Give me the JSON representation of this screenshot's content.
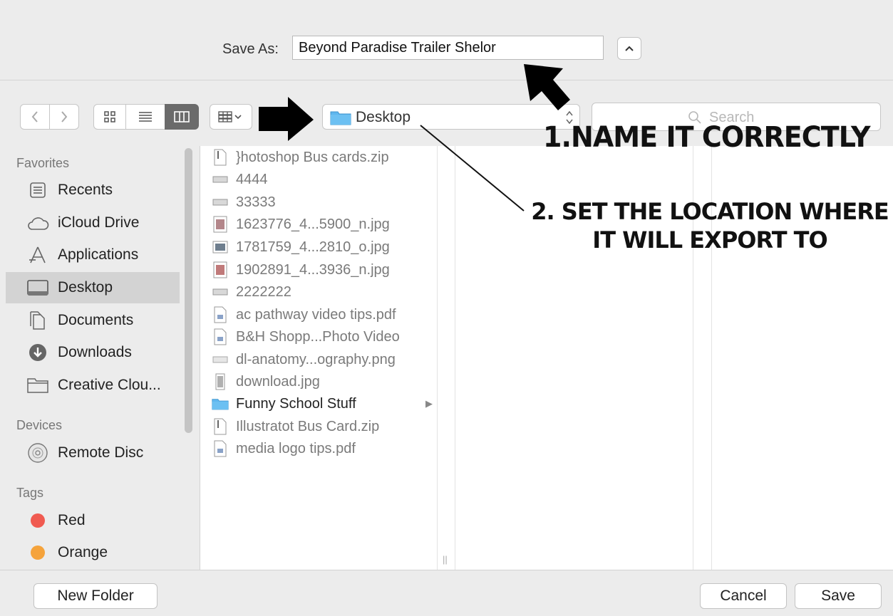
{
  "save_as": {
    "label": "Save As:",
    "filename": "Beyond Paradise Trailer Shelor"
  },
  "toolbar": {
    "location": "Desktop",
    "search_placeholder": "Search",
    "active_view": "column"
  },
  "sidebar": {
    "favorites_heading": "Favorites",
    "favorites": [
      {
        "label": "Recents",
        "icon": "recents-icon"
      },
      {
        "label": "iCloud Drive",
        "icon": "cloud-icon"
      },
      {
        "label": "Applications",
        "icon": "applications-icon"
      },
      {
        "label": "Desktop",
        "icon": "desktop-icon",
        "selected": true
      },
      {
        "label": "Documents",
        "icon": "documents-icon"
      },
      {
        "label": "Downloads",
        "icon": "downloads-icon"
      },
      {
        "label": "Creative Clou...",
        "icon": "folder-icon"
      }
    ],
    "devices_heading": "Devices",
    "devices": [
      {
        "label": "Remote Disc",
        "icon": "disc-icon"
      }
    ],
    "tags_heading": "Tags",
    "tags": [
      {
        "label": "Red",
        "color": "#f05a50"
      },
      {
        "label": "Orange",
        "color": "#f5a33b"
      }
    ]
  },
  "files": [
    {
      "name": "}hotoshop Bus cards.zip",
      "icon": "zip-icon"
    },
    {
      "name": "4444",
      "icon": "image-file-icon"
    },
    {
      "name": "33333",
      "icon": "image-file-icon"
    },
    {
      "name": "1623776_4...5900_n.jpg",
      "icon": "photo-icon"
    },
    {
      "name": "1781759_4...2810_o.jpg",
      "icon": "photo-icon"
    },
    {
      "name": "1902891_4...3936_n.jpg",
      "icon": "photo-icon"
    },
    {
      "name": "2222222",
      "icon": "image-file-icon"
    },
    {
      "name": "ac pathway video tips.pdf",
      "icon": "pdf-icon"
    },
    {
      "name": "B&H Shopp...Photo Video",
      "icon": "pdf-icon"
    },
    {
      "name": "dl-anatomy...ography.png",
      "icon": "image-file-icon"
    },
    {
      "name": "download.jpg",
      "icon": "photo-icon"
    },
    {
      "name": "Funny School Stuff",
      "icon": "folder-icon",
      "folder": true
    },
    {
      "name": "Illustratot Bus Card.zip",
      "icon": "zip-icon"
    },
    {
      "name": "media logo tips.pdf",
      "icon": "pdf-icon"
    }
  ],
  "buttons": {
    "new_folder": "New Folder",
    "cancel": "Cancel",
    "save": "Save"
  },
  "annotations": {
    "step1": "1.NAME IT CORRECTLY",
    "step2": "2. SET THE LOCATION WHERE IT WILL EXPORT TO"
  },
  "colors": {
    "folder_blue": "#5eb6ee",
    "selection_gray": "#d3d3d3"
  }
}
